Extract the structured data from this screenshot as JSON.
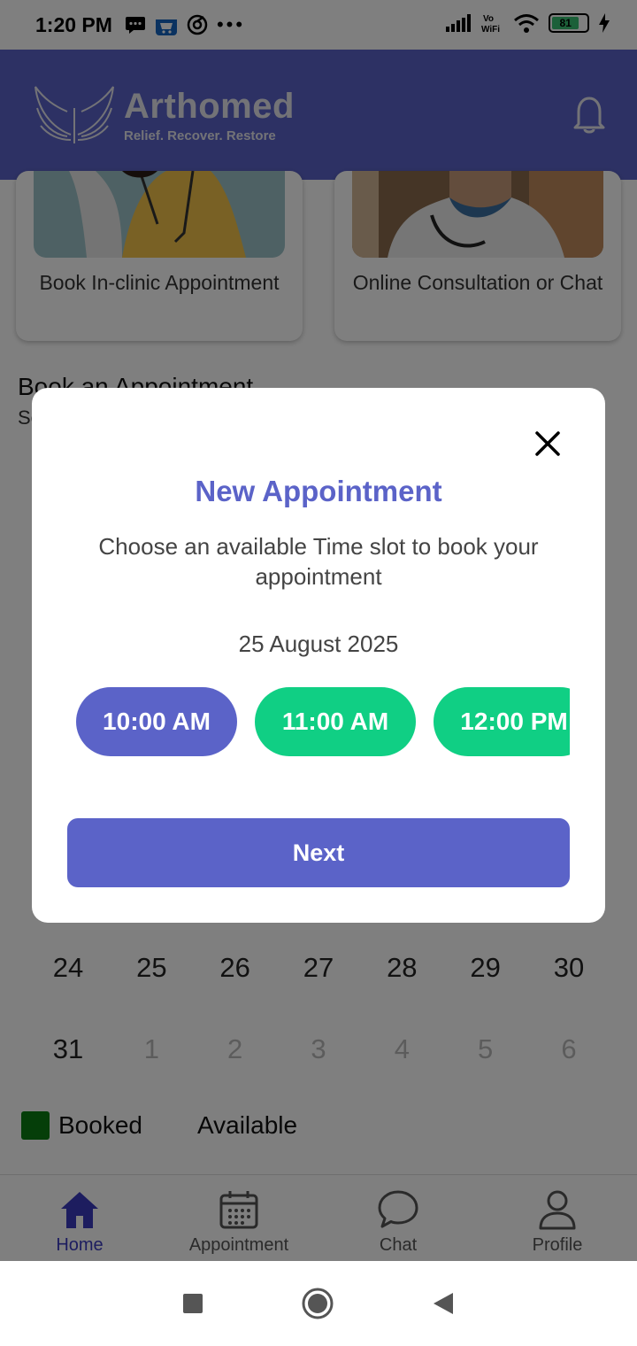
{
  "status_bar": {
    "time": "1:20 PM",
    "battery": "81",
    "icons": [
      "message-icon",
      "amazon-icon",
      "vpn-icon",
      "more-icon",
      "signal-icon",
      "vowifi-icon",
      "wifi-icon",
      "battery-icon",
      "charging-icon"
    ]
  },
  "header": {
    "brand_name": "Arthomed",
    "tagline": "Relief. Recover. Restore",
    "logo_icon": "wings-icon",
    "notification_icon": "bell-icon"
  },
  "services": [
    {
      "label": "Book In-clinic Appointment"
    },
    {
      "label": "Online Consultation or Chat"
    }
  ],
  "section": {
    "title": "Book an Appointment",
    "subtitle": "Se"
  },
  "calendar": {
    "row1": [
      "24",
      "25",
      "26",
      "27",
      "28",
      "29",
      "30"
    ],
    "row2": [
      "31",
      "1",
      "2",
      "3",
      "4",
      "5",
      "6"
    ]
  },
  "legend": {
    "booked": "Booked",
    "available": "Available",
    "booked_color": "#0a7d13"
  },
  "dialog": {
    "title": "New Appointment",
    "description": "Choose an available Time slot to book your appointment",
    "date": "25 August 2025",
    "slots": [
      {
        "time": "10:00 AM",
        "state": "selected"
      },
      {
        "time": "11:00 AM",
        "state": "available"
      },
      {
        "time": "12:00 PM",
        "state": "available"
      }
    ],
    "next_label": "Next",
    "accent_color": "#5b63c8",
    "available_color": "#10cf84"
  },
  "bottom_nav": [
    {
      "label": "Home",
      "icon": "home-icon",
      "active": true
    },
    {
      "label": "Appointment",
      "icon": "calendar-icon",
      "active": false
    },
    {
      "label": "Chat",
      "icon": "chat-icon",
      "active": false
    },
    {
      "label": "Profile",
      "icon": "profile-icon",
      "active": false
    }
  ]
}
